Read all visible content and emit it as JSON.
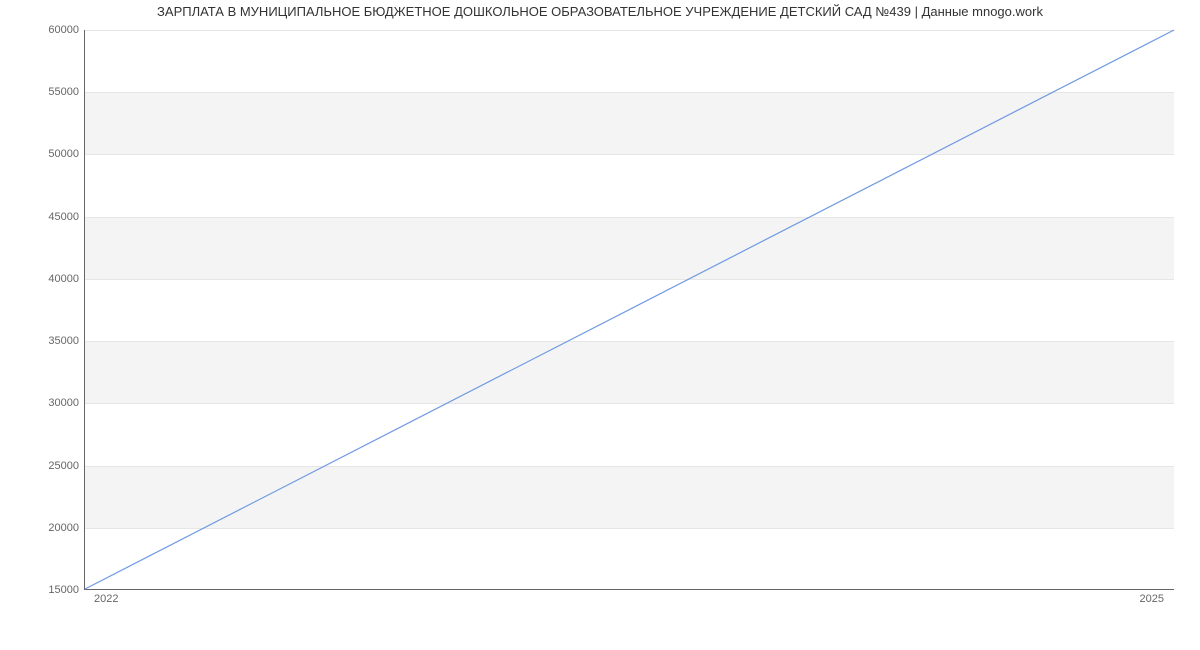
{
  "chart_data": {
    "type": "line",
    "title": "ЗАРПЛАТА В МУНИЦИПАЛЬНОЕ БЮДЖЕТНОЕ ДОШКОЛЬНОЕ ОБРАЗОВАТЕЛЬНОЕ УЧРЕЖДЕНИЕ ДЕТСКИЙ САД №439 | Данные mnogo.work",
    "x": [
      2022,
      2025
    ],
    "values": [
      15000,
      60000
    ],
    "xlim": [
      2022,
      2025
    ],
    "ylim": [
      15000,
      60000
    ],
    "y_ticks": [
      15000,
      20000,
      25000,
      30000,
      35000,
      40000,
      45000,
      50000,
      55000,
      60000
    ],
    "x_ticks": [
      "2022",
      "2025"
    ],
    "line_color": "#6f9ae3",
    "band_color": "#f4f4f4",
    "gridline_color": "#e6e6e6"
  }
}
